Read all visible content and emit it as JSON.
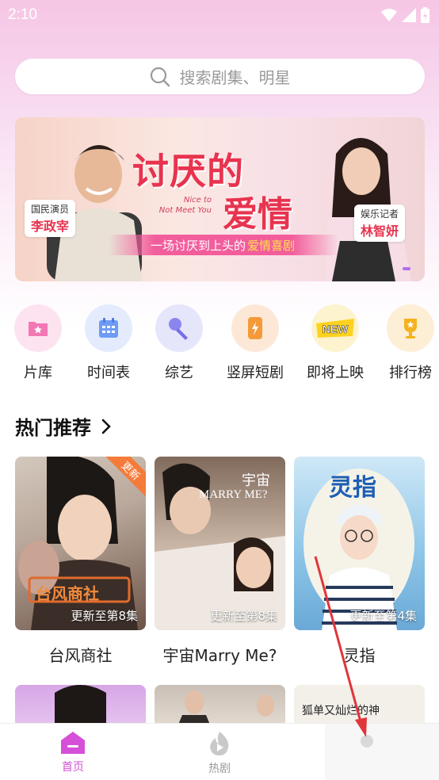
{
  "status_bar": {
    "time": "2:10"
  },
  "search": {
    "placeholder": "搜索剧集、明星"
  },
  "banner": {
    "title_line1": "讨厌的",
    "title_line2": "爱情",
    "english_line1": "Nice to",
    "english_line2": "Not Meet You",
    "tagline_prefix": "一场讨厌到上头的",
    "tagline_highlight": "爱情喜剧",
    "left_role": "国民演员",
    "left_name": "李政宰",
    "right_role": "娱乐记者",
    "right_name": "林智妍"
  },
  "categories": [
    {
      "label": "片库",
      "icon": "film-library-icon",
      "bg": "#fde3ef"
    },
    {
      "label": "时间表",
      "icon": "calendar-icon",
      "bg": "#e3ebfd"
    },
    {
      "label": "综艺",
      "icon": "microphone-icon",
      "bg": "#e6e6fb"
    },
    {
      "label": "竖屏短剧",
      "icon": "lightning-phone-icon",
      "bg": "#fde8d8"
    },
    {
      "label": "即将上映",
      "icon": "new-badge-icon",
      "bg": "#fdf3cf"
    },
    {
      "label": "排行榜",
      "icon": "trophy-icon",
      "bg": "#fdeed6"
    }
  ],
  "section": {
    "title": "热门推荐"
  },
  "cards": [
    {
      "title": "台风商社",
      "update": "更新至第8集",
      "badge": "更新",
      "poster_text": "台风商社"
    },
    {
      "title": "宇宙Marry Me?",
      "update": "更新至第8集",
      "poster_text_1": "宇宙",
      "poster_text_2": "MARRY ME?"
    },
    {
      "title": "灵指",
      "update": "更新至第4集",
      "poster_text": "灵指"
    }
  ],
  "row2_text": "狐单又灿烂的神",
  "bottom_nav": {
    "items": [
      {
        "label": "首页",
        "active": true,
        "color": "#d64fd8"
      },
      {
        "label": "热剧",
        "active": false,
        "color": "#9a9a9a"
      }
    ]
  },
  "colors": {
    "accent": "#d64fd8",
    "banner_title": "#e8334f"
  }
}
